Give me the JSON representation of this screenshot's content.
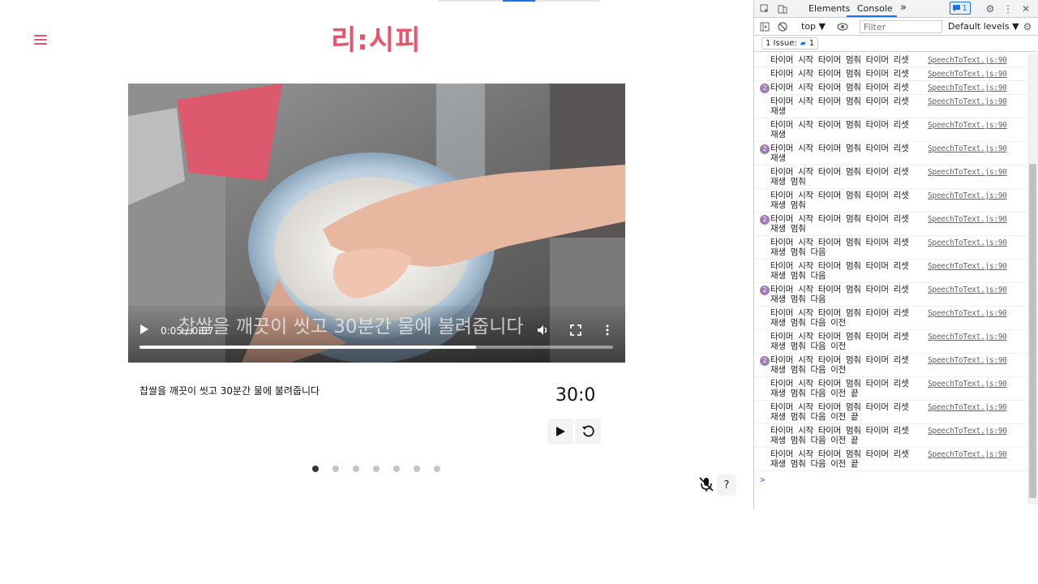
{
  "app": {
    "logo": "리:시피",
    "video": {
      "subtitle": "찹쌀을 깨끗이 씻고 30분간 물에 불려줍니다",
      "time": "0:05 / 0:07",
      "progress": 0.71
    },
    "step_text": "찹쌀을 깨끗이 씻고 30분간 물에 불려줍니다",
    "timer": "30:0",
    "pagination": {
      "count": 7,
      "active": 0
    },
    "help_label": "?"
  },
  "devtools": {
    "tabs": {
      "elements": "Elements",
      "console": "Console",
      "more": "»"
    },
    "issue_badge_count": "1",
    "context": "top ▼",
    "filter_placeholder": "Filter",
    "levels": "Default levels ▼",
    "issues_label": "1 Issue:",
    "issues_count": "1",
    "prompt": ">",
    "log_source": "SpeechToText.js:90",
    "logs": [
      {
        "count": "",
        "msg": "타이머 시작 타이머 멈춰 타이머 리셋"
      },
      {
        "count": "",
        "msg": "타이머 시작 타이머 멈춰 타이머 리셋"
      },
      {
        "count": "2",
        "msg": "타이머 시작 타이머 멈춰 타이머 리셋"
      },
      {
        "count": "",
        "msg": "타이머 시작 타이머 멈춰 타이머 리셋 재생"
      },
      {
        "count": "",
        "msg": "타이머 시작 타이머 멈춰 타이머 리셋 재생"
      },
      {
        "count": "2",
        "msg": "타이머 시작 타이머 멈춰 타이머 리셋 재생"
      },
      {
        "count": "",
        "msg": "타이머 시작 타이머 멈춰 타이머 리셋 재생 멈춰"
      },
      {
        "count": "",
        "msg": "타이머 시작 타이머 멈춰 타이머 리셋 재생 멈춰"
      },
      {
        "count": "2",
        "msg": "타이머 시작 타이머 멈춰 타이머 리셋 재생 멈춰"
      },
      {
        "count": "",
        "msg": "타이머 시작 타이머 멈춰 타이머 리셋 재생 멈춰 다음"
      },
      {
        "count": "",
        "msg": "타이머 시작 타이머 멈춰 타이머 리셋 재생 멈춰 다음"
      },
      {
        "count": "2",
        "msg": "타이머 시작 타이머 멈춰 타이머 리셋 재생 멈춰 다음"
      },
      {
        "count": "",
        "msg": "타이머 시작 타이머 멈춰 타이머 리셋 재생 멈춰 다음 이전"
      },
      {
        "count": "",
        "msg": "타이머 시작 타이머 멈춰 타이머 리셋 재생 멈춰 다음 이전"
      },
      {
        "count": "2",
        "msg": "타이머 시작 타이머 멈춰 타이머 리셋 재생 멈춰 다음 이전"
      },
      {
        "count": "",
        "msg": "타이머 시작 타이머 멈춰 타이머 리셋 재생 멈춰 다음 이전 끝"
      },
      {
        "count": "",
        "msg": "타이머 시작 타이머 멈춰 타이머 리셋 재생 멈춰 다음 이전 끝"
      },
      {
        "count": "",
        "msg": "타이머 시작 타이머 멈춰 타이머 리셋 재생 멈춰 다음 이전 끝"
      },
      {
        "count": "",
        "msg": "타이머 시작 타이머 멈춰 타이머 리셋 재생 멈춰 다음 이전 끝"
      }
    ]
  }
}
